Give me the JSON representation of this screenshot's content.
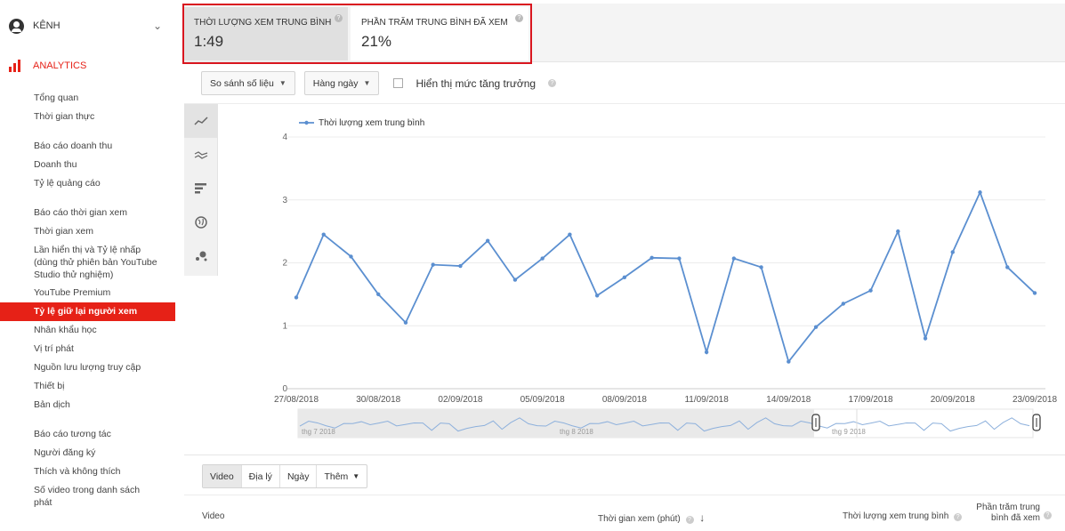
{
  "sidebar": {
    "channel_label": "KÊNH",
    "analytics_label": "ANALYTICS",
    "items": [
      {
        "label": "Tổng quan"
      },
      {
        "label": "Thời gian thực"
      },
      {
        "label": "Báo cáo doanh thu"
      },
      {
        "label": "Doanh thu"
      },
      {
        "label": "Tỷ lệ quảng cáo"
      },
      {
        "label": "Báo cáo thời gian xem"
      },
      {
        "label": "Thời gian xem"
      },
      {
        "label": "Lần hiển thị và Tỷ lệ nhấp (dùng thử phiên bản YouTube Studio thử nghiệm)"
      },
      {
        "label": "YouTube Premium"
      },
      {
        "label": "Tỷ lệ giữ lại người xem"
      },
      {
        "label": "Nhân khẩu học"
      },
      {
        "label": "Vị trí phát"
      },
      {
        "label": "Nguồn lưu lượng truy cập"
      },
      {
        "label": "Thiết bị"
      },
      {
        "label": "Bản dịch"
      },
      {
        "label": "Báo cáo tương tác"
      },
      {
        "label": "Người đăng ký"
      },
      {
        "label": "Thích và không thích"
      },
      {
        "label": "Số video trong danh sách phát"
      }
    ],
    "accent": "#e62117"
  },
  "metrics": [
    {
      "title": "THỜI LƯỢNG XEM TRUNG BÌNH",
      "value": "1:49"
    },
    {
      "title": "PHẦN TRĂM TRUNG BÌNH ĐÃ XEM",
      "value": "21%"
    }
  ],
  "controls": {
    "compare_label": "So sánh số liệu",
    "period_label": "Hàng ngày",
    "growth_label": "Hiển thị mức tăng trưởng",
    "growth_checked": false
  },
  "chart_types": [
    "line-chart-icon",
    "multi-line-icon",
    "bar-chart-icon",
    "globe-icon",
    "bubble-chart-icon"
  ],
  "chart_data": {
    "type": "line",
    "series": [
      {
        "name": "Thời lượng xem trung bình",
        "color": "#5b8fd0",
        "values": [
          1.45,
          2.45,
          2.1,
          1.5,
          1.05,
          1.97,
          1.95,
          2.35,
          1.73,
          2.07,
          2.45,
          1.48,
          1.77,
          2.08,
          2.07,
          0.58,
          2.07,
          1.93,
          0.43,
          0.98,
          1.35,
          1.56,
          2.5,
          0.8,
          2.17,
          3.12,
          1.93,
          1.52
        ]
      }
    ],
    "x": [
      "27/08/2018",
      "28/08/2018",
      "29/08/2018",
      "30/08/2018",
      "31/08/2018",
      "01/09/2018",
      "02/09/2018",
      "03/09/2018",
      "04/09/2018",
      "05/09/2018",
      "06/09/2018",
      "07/09/2018",
      "08/09/2018",
      "09/09/2018",
      "10/09/2018",
      "11/09/2018",
      "12/09/2018",
      "13/09/2018",
      "14/09/2018",
      "15/09/2018",
      "16/09/2018",
      "17/09/2018",
      "18/09/2018",
      "19/09/2018",
      "20/09/2018",
      "21/09/2018",
      "22/09/2018",
      "23/09/2018"
    ],
    "x_tick_labels": [
      "27/08/2018",
      "30/08/2018",
      "02/09/2018",
      "05/09/2018",
      "08/09/2018",
      "11/09/2018",
      "14/09/2018",
      "17/09/2018",
      "20/09/2018",
      "23/09/2018"
    ],
    "y_ticks": [
      "0",
      "1",
      "2",
      "3",
      "4"
    ],
    "ylim": [
      0,
      4
    ],
    "grid": true,
    "legend": "top-left",
    "navigator_labels": [
      "thg 7 2018",
      "thg 8 2018",
      "thg 9 2018"
    ]
  },
  "bottom": {
    "tabs": [
      "Video",
      "Địa lý",
      "Ngày",
      "Thêm"
    ],
    "columns": [
      "Video",
      "Thời gian xem (phút)",
      "Thời lượng xem trung bình",
      "Phần trăm trung bình đã xem"
    ]
  }
}
